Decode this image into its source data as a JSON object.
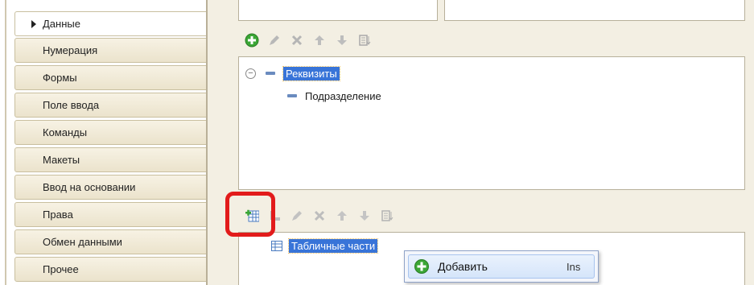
{
  "nav": {
    "items": [
      {
        "label": "Данные",
        "active": true
      },
      {
        "label": "Нумерация"
      },
      {
        "label": "Формы"
      },
      {
        "label": "Поле ввода"
      },
      {
        "label": "Команды"
      },
      {
        "label": "Макеты"
      },
      {
        "label": "Ввод на основании"
      },
      {
        "label": "Права"
      },
      {
        "label": "Обмен данными"
      },
      {
        "label": "Прочее"
      }
    ]
  },
  "attributes": {
    "root_label": "Реквизиты",
    "child_label": "Подразделение"
  },
  "tabular": {
    "root_label": "Табличные части"
  },
  "context_menu": {
    "add_label": "Добавить",
    "add_shortcut": "Ins"
  },
  "colors": {
    "selection": "#3874d8",
    "highlight": "#e21b1b",
    "add_green": "#3ba635"
  }
}
